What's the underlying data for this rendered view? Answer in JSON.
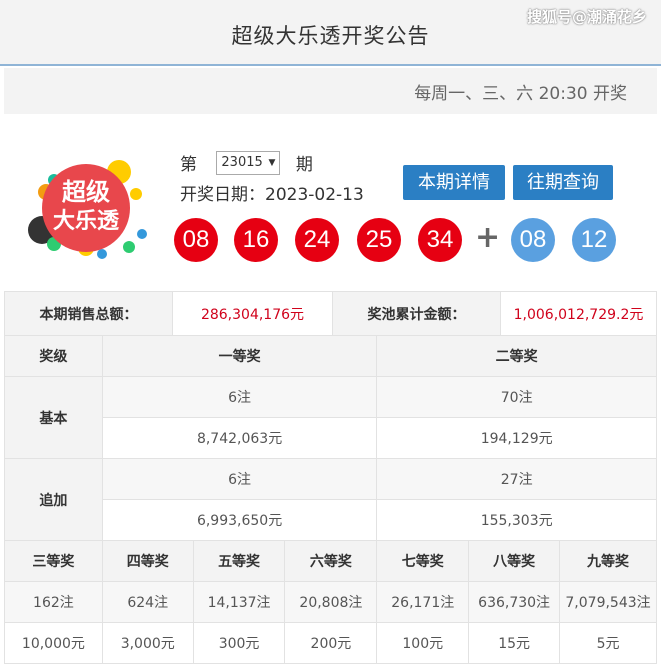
{
  "header": {
    "title": "超级大乐透开奖公告",
    "watermark": "搜狐号@潮涌花乡"
  },
  "schedule": "每周一、三、六 20:30 开奖",
  "logo": {
    "line1": "超级",
    "line2": "大乐透"
  },
  "issue": {
    "prefix": "第",
    "value": "23015",
    "suffix": "期"
  },
  "draw_date": "开奖日期：2023-02-13",
  "buttons": {
    "detail": "本期详情",
    "history": "往期查询"
  },
  "balls": {
    "front": [
      "08",
      "16",
      "24",
      "25",
      "34"
    ],
    "plus": "+",
    "back": [
      "08",
      "12"
    ]
  },
  "sales": {
    "sales_label": "本期销售总额：",
    "sales_value": "286,304,176元",
    "pool_label": "奖池累计金额：",
    "pool_value": "1,006,012,729.2元"
  },
  "prize_table": {
    "col_level": "奖级",
    "first": "一等奖",
    "second": "二等奖",
    "basic_label": "基本",
    "basic_first_count": "6注",
    "basic_second_count": "70注",
    "basic_first_amount": "8,742,063元",
    "basic_second_amount": "194,129元",
    "add_label": "追加",
    "add_first_count": "6注",
    "add_second_count": "27注",
    "add_first_amount": "6,993,650元",
    "add_second_amount": "155,303元",
    "lower_levels": [
      "三等奖",
      "四等奖",
      "五等奖",
      "六等奖",
      "七等奖",
      "八等奖",
      "九等奖"
    ],
    "lower_counts": [
      "162注",
      "624注",
      "14,137注",
      "20,808注",
      "26,171注",
      "636,730注",
      "7,079,543注"
    ],
    "lower_amounts": [
      "10,000元",
      "3,000元",
      "300元",
      "200元",
      "100元",
      "15元",
      "5元"
    ]
  },
  "colors": {
    "accent_blue": "#2b7fc4",
    "red_ball": "#e60012",
    "blue_ball": "#5aa0e0",
    "money_red": "#d0021b"
  }
}
